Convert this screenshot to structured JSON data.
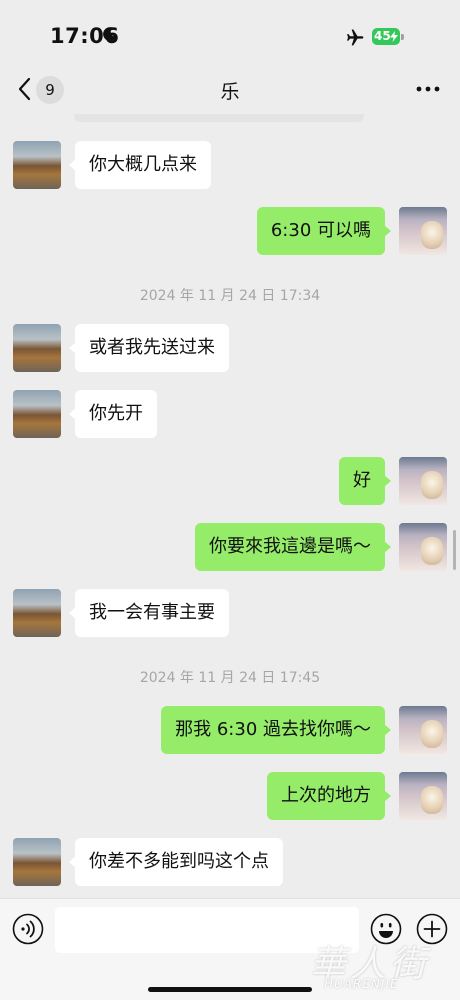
{
  "status_bar": {
    "time": "17:06",
    "battery": "45"
  },
  "header": {
    "unread_count": "9",
    "title": "乐"
  },
  "messages": [
    {
      "side": "in",
      "text": "你大概几点来"
    },
    {
      "side": "out",
      "text": "6:30 可以嗎"
    },
    {
      "side": "in",
      "text": "或者我先送过来"
    },
    {
      "side": "in",
      "text": "你先开"
    },
    {
      "side": "out",
      "text": "好"
    },
    {
      "side": "out",
      "text": "你要來我這邊是嗎～"
    },
    {
      "side": "in",
      "text": "我一会有事主要"
    },
    {
      "side": "out",
      "text": "那我 6:30 過去找你嗎～"
    },
    {
      "side": "out",
      "text": "上次的地方"
    },
    {
      "side": "in",
      "text": "你差不多能到吗这个点"
    }
  ],
  "timestamps": [
    "2024 年 11 月 24 日 17:34",
    "2024 年 11 月 24 日 17:45"
  ],
  "input": {
    "placeholder": ""
  },
  "watermark": {
    "chinese": "華人街",
    "latin": "HUARENJIE"
  },
  "colors": {
    "outgoing_bubble": "#95ec69",
    "incoming_bubble": "#ffffff",
    "background": "#ededed",
    "battery": "#34c759"
  },
  "icons": [
    "moon-icon",
    "airplane-icon",
    "battery-icon",
    "back-chevron-icon",
    "more-dots-icon",
    "voice-icon",
    "emoji-icon",
    "plus-icon"
  ]
}
